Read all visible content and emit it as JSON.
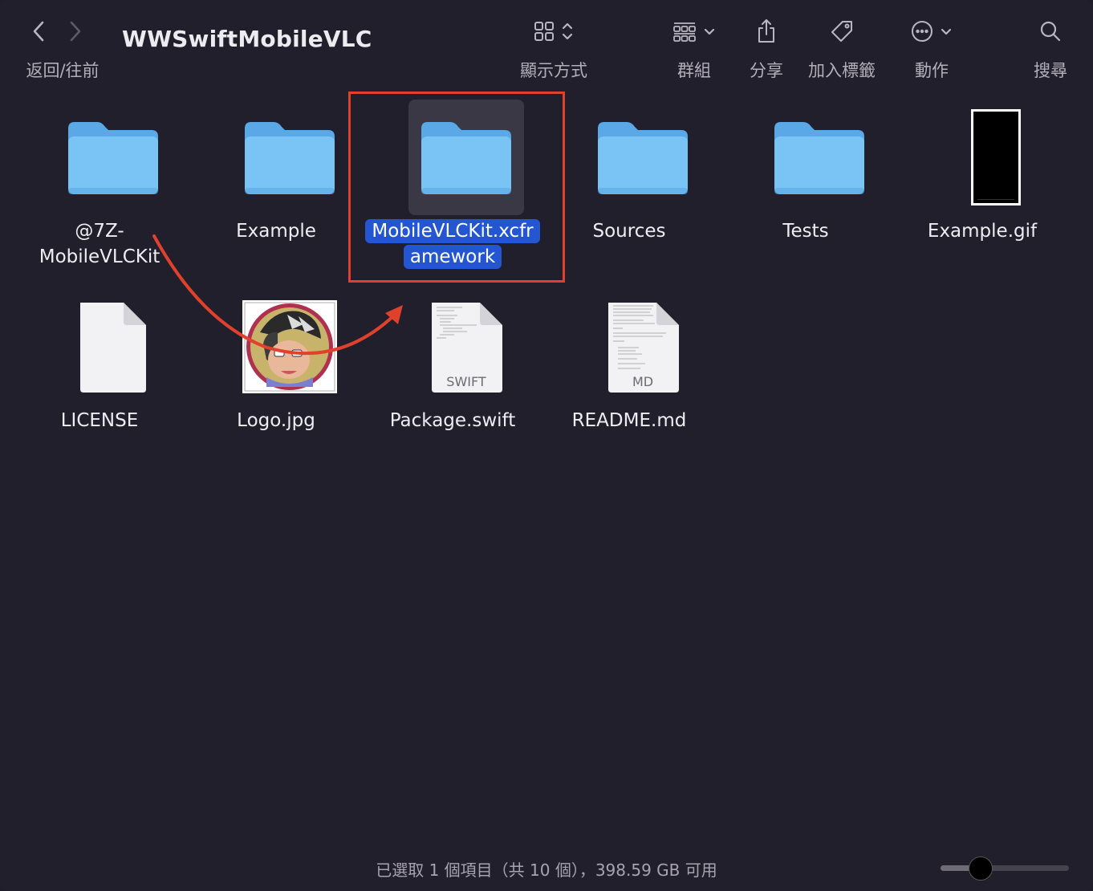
{
  "window": {
    "title": "WWSwiftMobileVLC"
  },
  "toolbar": {
    "nav_label": "返回/往前",
    "view_label": "顯示方式",
    "group_label": "群組",
    "share_label": "分享",
    "tags_label": "加入標籤",
    "action_label": "動作",
    "search_label": "搜尋",
    "icons": {
      "back": "chevron-left-icon",
      "forward": "chevron-right-icon",
      "view": "icon-grid-icon",
      "group": "group-grid-icon",
      "share": "share-icon",
      "tags": "tag-icon",
      "action": "ellipsis-circle-icon",
      "search": "magnifier-icon"
    }
  },
  "files": [
    {
      "name": "@7Z-MobileVLCKit",
      "name_line1": "@7Z-",
      "name_line2": "MobileVLCKit",
      "kind": "folder",
      "selected": false
    },
    {
      "name": "Example",
      "kind": "folder",
      "selected": false
    },
    {
      "name": "MobileVLCKit.xcframework",
      "name_line1": "MobileVLCKit.xcfr",
      "name_line2": "amework",
      "kind": "folder",
      "selected": true
    },
    {
      "name": "Sources",
      "kind": "folder",
      "selected": false
    },
    {
      "name": "Tests",
      "kind": "folder",
      "selected": false
    },
    {
      "name": "Example.gif",
      "kind": "gif-thumbnail",
      "selected": false
    },
    {
      "name": "LICENSE",
      "kind": "document",
      "selected": false
    },
    {
      "name": "Logo.jpg",
      "kind": "image-thumbnail",
      "selected": false
    },
    {
      "name": "Package.swift",
      "kind": "document",
      "doc_label": "SWIFT",
      "selected": false
    },
    {
      "name": "README.md",
      "kind": "document",
      "doc_label": "MD",
      "selected": false
    }
  ],
  "annotation": {
    "highlight_color": "#e0412d",
    "arrow_color": "#e0412d"
  },
  "colors": {
    "folder_top": "#5fb0ec",
    "folder_body": "#74c0f4",
    "selection": "#2456d1",
    "background": "#211f2b"
  },
  "status": {
    "text": "已選取 1 個項目（共 10 個），398.59 GB 可用"
  },
  "zoom_slider": {
    "value": 0.27
  }
}
